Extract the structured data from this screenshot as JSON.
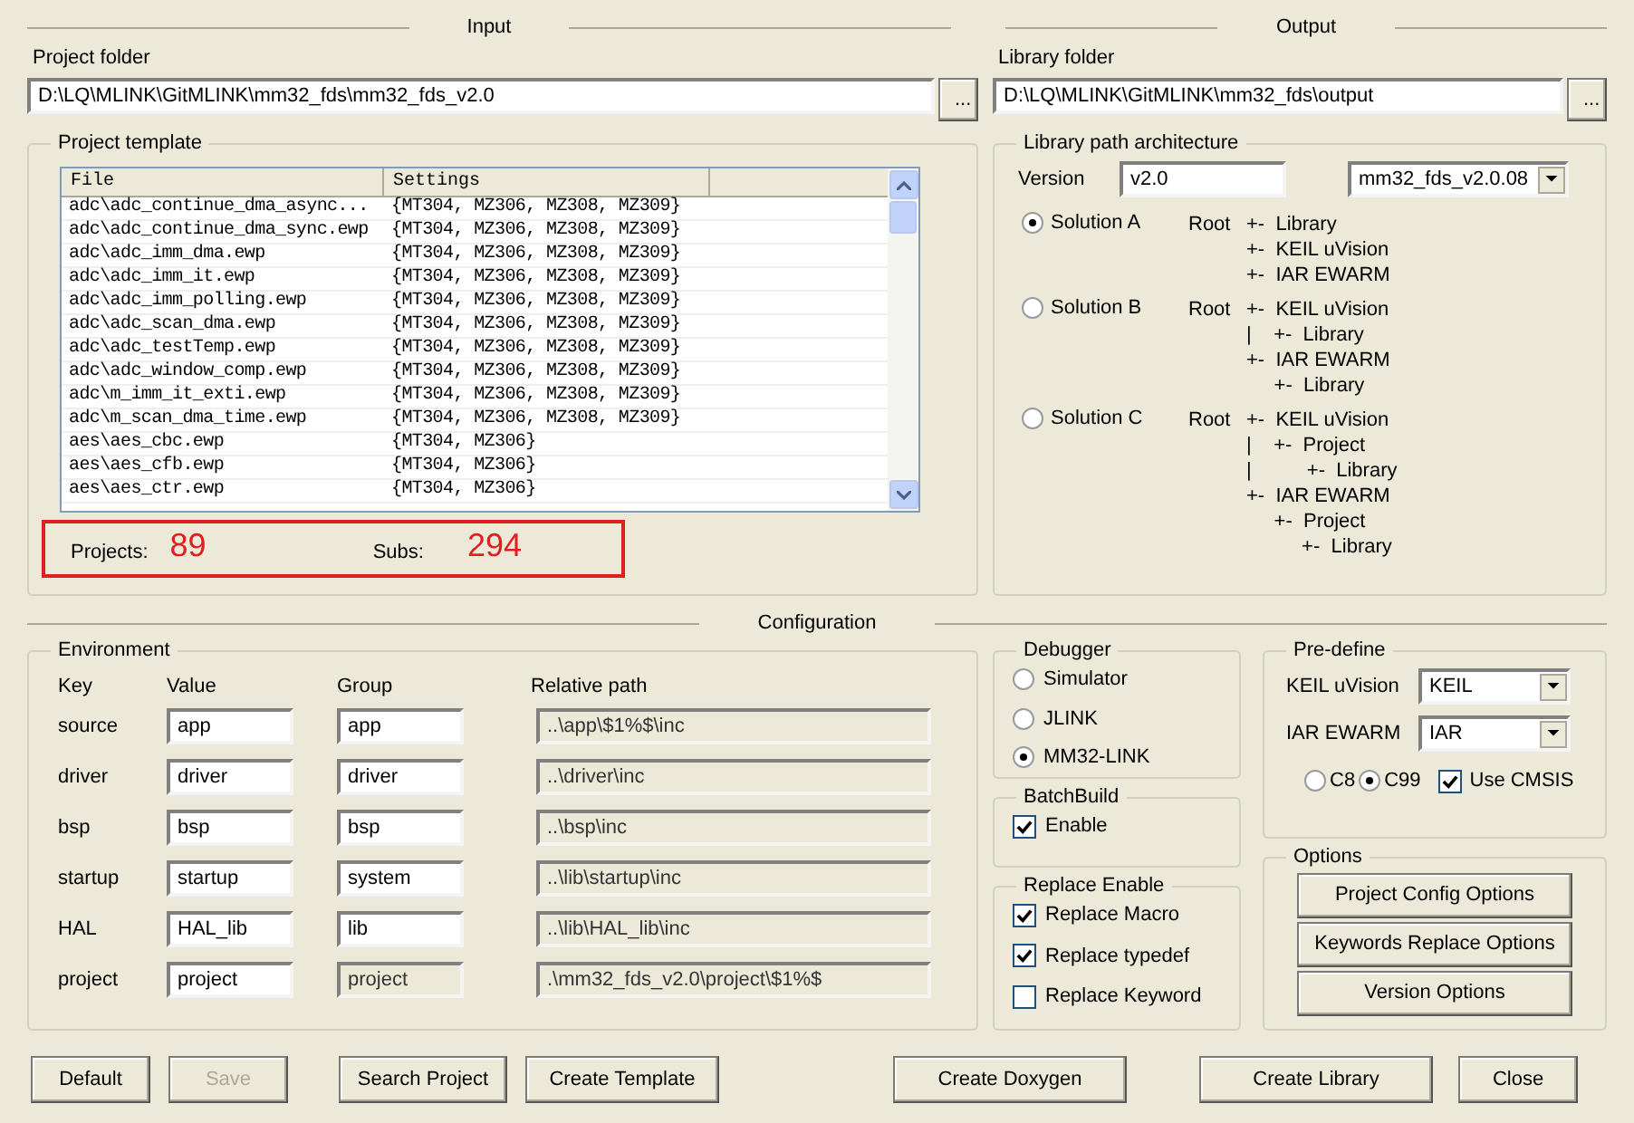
{
  "input": {
    "title": "Input",
    "project_folder": {
      "label": "Project folder",
      "value": "D:\\LQ\\MLINK\\GitMLINK\\mm32_fds\\mm32_fds_v2.0",
      "browse": "..."
    },
    "project_template": {
      "title": "Project template",
      "columns": [
        "File",
        "Settings"
      ],
      "rows": [
        [
          "adc\\adc_continue_dma_async...",
          "{MT304, MZ306, MZ308, MZ309}"
        ],
        [
          "adc\\adc_continue_dma_sync.ewp",
          "{MT304, MZ306, MZ308, MZ309}"
        ],
        [
          "adc\\adc_imm_dma.ewp",
          "{MT304, MZ306, MZ308, MZ309}"
        ],
        [
          "adc\\adc_imm_it.ewp",
          "{MT304, MZ306, MZ308, MZ309}"
        ],
        [
          "adc\\adc_imm_polling.ewp",
          "{MT304, MZ306, MZ308, MZ309}"
        ],
        [
          "adc\\adc_scan_dma.ewp",
          "{MT304, MZ306, MZ308, MZ309}"
        ],
        [
          "adc\\adc_testTemp.ewp",
          "{MT304, MZ306, MZ308, MZ309}"
        ],
        [
          "adc\\adc_window_comp.ewp",
          "{MT304, MZ306, MZ308, MZ309}"
        ],
        [
          "adc\\m_imm_it_exti.ewp",
          "{MT304, MZ306, MZ308, MZ309}"
        ],
        [
          "adc\\m_scan_dma_time.ewp",
          "{MT304, MZ306, MZ308, MZ309}"
        ],
        [
          "aes\\aes_cbc.ewp",
          "{MT304, MZ306}"
        ],
        [
          "aes\\aes_cfb.ewp",
          "{MT304, MZ306}"
        ],
        [
          "aes\\aes_ctr.ewp",
          "{MT304, MZ306}"
        ]
      ],
      "summary": {
        "projects_label": "Projects:",
        "projects": "89",
        "subs_label": "Subs:",
        "subs": "294"
      }
    }
  },
  "output": {
    "title": "Output",
    "library_folder": {
      "label": "Library folder",
      "value": "D:\\LQ\\MLINK\\GitMLINK\\mm32_fds\\output",
      "browse": "..."
    },
    "architecture": {
      "title": "Library path architecture",
      "version_label": "Version",
      "version": "v2.0",
      "version_select": "mm32_fds_v2.0.08",
      "solutions": [
        {
          "label": "Solution A",
          "selected": true,
          "root": "Root",
          "lines": [
            "+-  Library",
            "+-  KEIL uVision",
            "+-  IAR EWARM"
          ]
        },
        {
          "label": "Solution B",
          "selected": false,
          "root": "Root",
          "lines": [
            "+-  KEIL uVision",
            "|    +-  Library",
            "+-  IAR EWARM",
            "     +-  Library"
          ]
        },
        {
          "label": "Solution C",
          "selected": false,
          "root": "Root",
          "lines": [
            "+-  KEIL uVision",
            "|    +-  Project",
            "|          +-  Library",
            "+-  IAR EWARM",
            "     +-  Project",
            "          +-  Library"
          ]
        }
      ]
    }
  },
  "configuration": {
    "title": "Configuration",
    "environment": {
      "title": "Environment",
      "headers": [
        "Key",
        "Value",
        "Group",
        "Relative path"
      ],
      "rows": [
        {
          "key": "source",
          "value": "app",
          "group": "app",
          "group_disabled": false,
          "path": "..\\app\\$1%$\\inc"
        },
        {
          "key": "driver",
          "value": "driver",
          "group": "driver",
          "group_disabled": false,
          "path": "..\\driver\\inc"
        },
        {
          "key": "bsp",
          "value": "bsp",
          "group": "bsp",
          "group_disabled": false,
          "path": "..\\bsp\\inc"
        },
        {
          "key": "startup",
          "value": "startup",
          "group": "system",
          "group_disabled": false,
          "path": "..\\lib\\startup\\inc"
        },
        {
          "key": "HAL",
          "value": "HAL_lib",
          "group": "lib",
          "group_disabled": false,
          "path": "..\\lib\\HAL_lib\\inc"
        },
        {
          "key": "project",
          "value": "project",
          "group": "project",
          "group_disabled": true,
          "path": ".\\mm32_fds_v2.0\\project\\$1%$"
        }
      ]
    },
    "debugger": {
      "title": "Debugger",
      "options": [
        {
          "label": "Simulator",
          "selected": false
        },
        {
          "label": "JLINK",
          "selected": false
        },
        {
          "label": "MM32-LINK",
          "selected": true
        }
      ]
    },
    "batch_build": {
      "title": "BatchBuild",
      "items": [
        {
          "label": "Enable",
          "checked": true
        }
      ]
    },
    "replace_enable": {
      "title": "Replace Enable",
      "items": [
        {
          "label": "Replace Macro",
          "checked": true
        },
        {
          "label": "Replace typedef",
          "checked": true
        },
        {
          "label": "Replace Keyword",
          "checked": false
        }
      ]
    },
    "predefine": {
      "title": "Pre-define",
      "selects": [
        {
          "label": "KEIL uVision",
          "value": "KEIL"
        },
        {
          "label": "IAR EWARM",
          "value": "IAR"
        }
      ],
      "standards": [
        {
          "label": "C8",
          "selected": false
        },
        {
          "label": "C99",
          "selected": true
        }
      ],
      "use_cmsis": {
        "label": "Use CMSIS",
        "checked": true
      }
    },
    "options": {
      "title": "Options",
      "buttons": [
        "Project Config Options",
        "Keywords Replace Options",
        "Version Options"
      ]
    }
  },
  "buttons": [
    {
      "label": "Default",
      "disabled": false
    },
    {
      "label": "Save",
      "disabled": true
    },
    {
      "label": "Search Project",
      "disabled": false
    },
    {
      "label": "Create Template",
      "disabled": false
    },
    {
      "label": "Create Doxygen",
      "disabled": false
    },
    {
      "label": "Create Library",
      "disabled": false
    },
    {
      "label": "Close",
      "disabled": false
    }
  ]
}
